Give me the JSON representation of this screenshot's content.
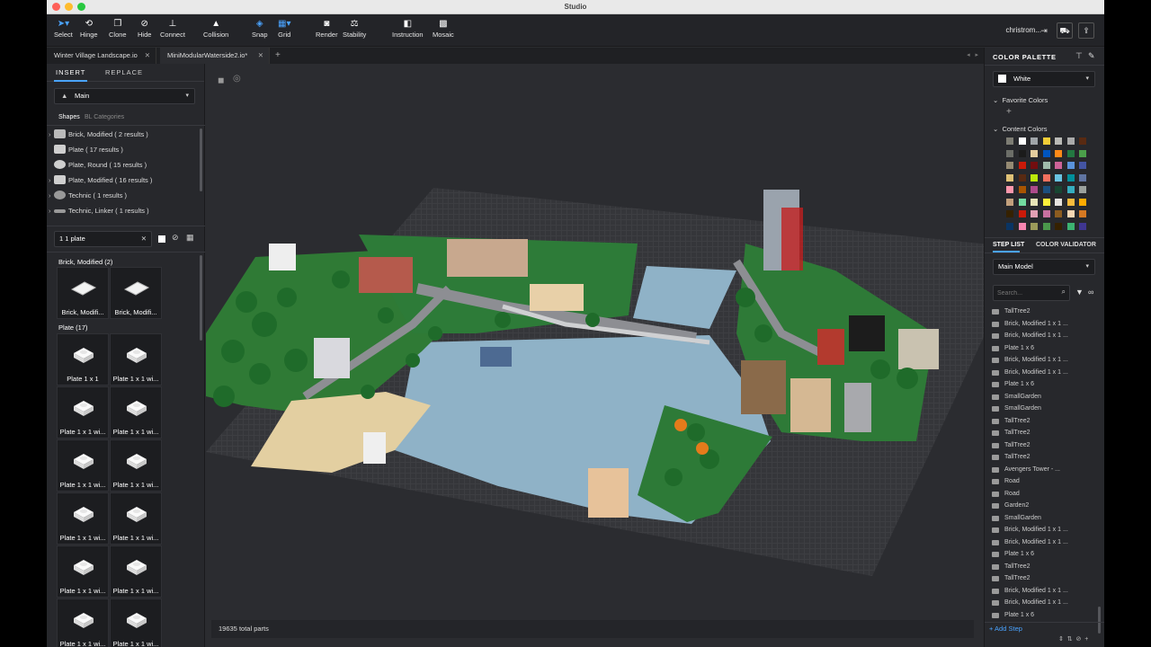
{
  "window": {
    "title": "Studio"
  },
  "toolbar": {
    "tools": [
      {
        "label": "Select",
        "icon": "cursor-icon"
      },
      {
        "label": "Hinge",
        "icon": "hinge-icon"
      },
      {
        "label": "Clone",
        "icon": "clone-icon"
      },
      {
        "label": "Hide",
        "icon": "eye-slash-icon"
      },
      {
        "label": "Connect",
        "icon": "connect-icon"
      },
      {
        "label": "Collision",
        "icon": "warning-icon"
      },
      {
        "label": "Snap",
        "icon": "snap-icon"
      },
      {
        "label": "Grid",
        "icon": "grid-icon"
      },
      {
        "label": "Render",
        "icon": "camera-icon"
      },
      {
        "label": "Stability",
        "icon": "stability-icon"
      },
      {
        "label": "Instruction",
        "icon": "instruction-icon"
      },
      {
        "label": "Mosaic",
        "icon": "mosaic-icon"
      }
    ],
    "account": "christrom..."
  },
  "doc_tabs": [
    {
      "label": "Winter Village Landscape.io"
    },
    {
      "label": "MiniModularWaterside2.io*"
    }
  ],
  "left_panel": {
    "tabs": [
      "INSERT",
      "REPLACE"
    ],
    "palette_select": "Main",
    "subtabs": [
      "Shapes",
      "BL Categories"
    ],
    "categories": [
      {
        "label": "Brick, Modified ( 2 results )"
      },
      {
        "label": "Plate ( 17 results )"
      },
      {
        "label": "Plate, Round ( 15 results )"
      },
      {
        "label": "Plate, Modified ( 16 results )"
      },
      {
        "label": "Technic ( 1 results )"
      },
      {
        "label": "Technic, Linker ( 1 results )"
      }
    ],
    "search_value": "1 1 plate",
    "groups": [
      {
        "title": "Brick, Modified (2)",
        "parts": [
          "Brick, Modifi...",
          "Brick, Modifi..."
        ]
      },
      {
        "title": "Plate (17)",
        "parts": [
          "Plate 1 x 1",
          "Plate 1 x 1 wi...",
          "Plate 1 x 1 wi...",
          "Plate 1 x 1 wi...",
          "Plate 1 x 1 wi...",
          "Plate 1 x 1 wi...",
          "Plate 1 x 1 wi...",
          "Plate 1 x 1 wi...",
          "Plate 1 x 1 wi...",
          "Plate 1 x 1 wi...",
          "Plate 1 x 1 wi...",
          "Plate 1 x 1 wi..."
        ]
      }
    ]
  },
  "viewport": {
    "status": "19635 total parts"
  },
  "right_panel": {
    "color_palette_title": "COLOR PALETTE",
    "selected_color": "White",
    "favorite_colors": "Favorite Colors",
    "content_colors": "Content Colors",
    "swatches": [
      "#7d7d74",
      "#ffffff",
      "#a0a5a9",
      "#f2cd37",
      "#b9b9b5",
      "#aaaaaa",
      "#582a12",
      "#6c6e68",
      "#1b1b1b",
      "#e4cd9e",
      "#0055bf",
      "#fe8a18",
      "#237841",
      "#4b9f4a",
      "#958a73",
      "#c91a09",
      "#720e0f",
      "#a0bcac",
      "#cd6298",
      "#5a93db",
      "#4354a3",
      "#dfc176",
      "#582a12",
      "#bbe90b",
      "#f2705e",
      "#69c3e2",
      "#008f9b",
      "#6074a1",
      "#fc97ac",
      "#a95500",
      "#ad4b8b",
      "#1b4f7e",
      "#184632",
      "#36aebf",
      "#9ba19d",
      "#c2a07d",
      "#73dca1",
      "#e7e4b7",
      "#fff03a",
      "#e6e3e0",
      "#f8bb3d",
      "#ffaa00",
      "#352100",
      "#c91a09",
      "#e2a0b4",
      "#c870a0",
      "#8c5c20",
      "#f6d7b3",
      "#d67923",
      "#0a3463",
      "#f785b1",
      "#9b9a5a",
      "#4b974b",
      "#352100",
      "#3cb371",
      "#3f3691"
    ],
    "step_tabs": [
      "STEP LIST",
      "COLOR VALIDATOR"
    ],
    "model_select": "Main Model",
    "search_placeholder": "Search...",
    "steps": [
      "TallTree2",
      "Brick, Modified 1 x 1 ...",
      "Brick, Modified 1 x 1 ...",
      "Plate 1 x 6",
      "Brick, Modified 1 x 1 ...",
      "Brick, Modified 1 x 1 ...",
      "Plate 1 x 6",
      "SmallGarden",
      "SmallGarden",
      "TallTree2",
      "TallTree2",
      "TallTree2",
      "TallTree2",
      "Avengers Tower - ...",
      "Road",
      "Road",
      "Garden2",
      "SmallGarden",
      "Brick, Modified 1 x 1 ...",
      "Brick, Modified 1 x 1 ...",
      "Plate 1 x 6",
      "TallTree2",
      "TallTree2",
      "Brick, Modified 1 x 1 ...",
      "Brick, Modified 1 x 1 ...",
      "Plate 1 x 6"
    ],
    "add_step": "+ Add Step"
  }
}
